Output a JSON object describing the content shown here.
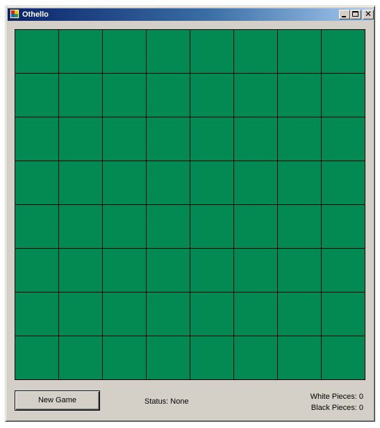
{
  "window": {
    "title": "Othello",
    "icon": "app-icon",
    "controls": [
      "minimize-icon",
      "maximize-icon",
      "close-icon"
    ]
  },
  "board": {
    "rows": 8,
    "cols": 8,
    "cell_color": "#038a52",
    "line_color": "#000000"
  },
  "controls": {
    "new_game_label": "New Game"
  },
  "status": {
    "text": "Status: None"
  },
  "score": {
    "white_text": "White Pieces: 0",
    "black_text": "Black Pieces: 0"
  }
}
